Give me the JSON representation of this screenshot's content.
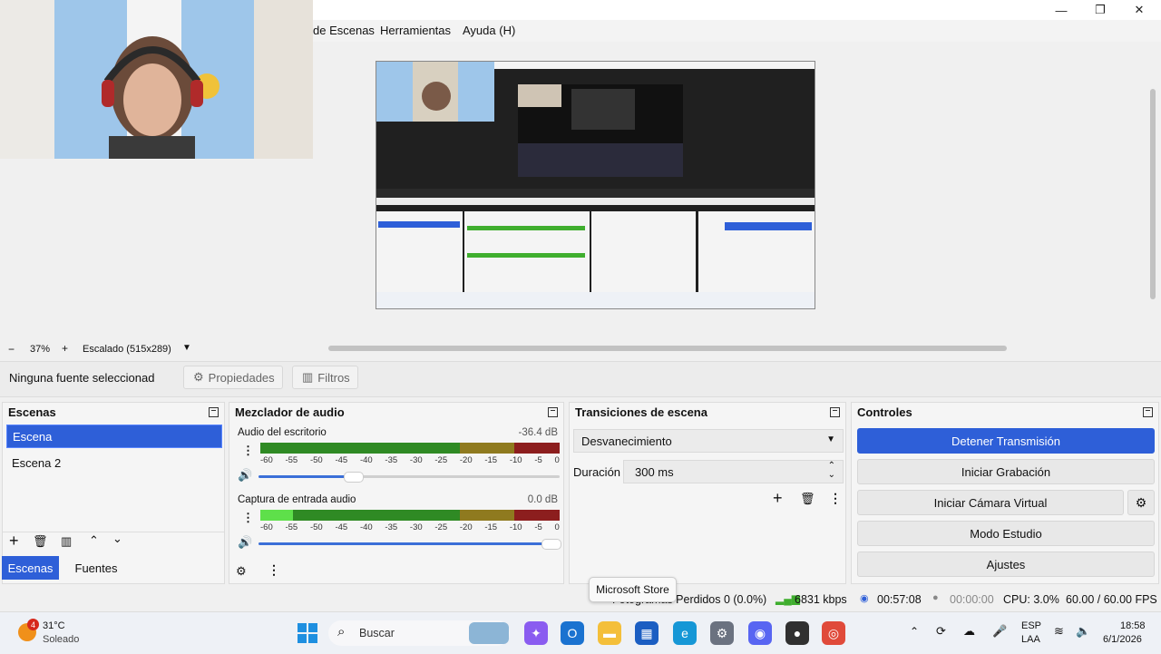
{
  "window": {
    "minimize": "—",
    "maximize": "❐",
    "close": "✕"
  },
  "menu": {
    "items": [
      "de Escenas",
      "Herramientas",
      "Ayuda (H)"
    ]
  },
  "zoom": {
    "minus": "−",
    "percent": "37%",
    "plus": "+",
    "scale": "Escalado (515x289)"
  },
  "sources_bar": {
    "status": "Ninguna fuente seleccionad",
    "properties": "Propiedades",
    "filters": "Filtros"
  },
  "scenes": {
    "title": "Escenas",
    "items": [
      "Escena",
      "Escena 2"
    ]
  },
  "mixer": {
    "title": "Mezclador de audio",
    "tracks": [
      {
        "name": "Audio del escritorio",
        "db": "-36.4 dB",
        "level": 0.0
      },
      {
        "name": "Captura de entrada audio",
        "db": "0.0 dB",
        "level": 0.2
      }
    ],
    "ticks": [
      "-60",
      "-55",
      "-50",
      "-45",
      "-40",
      "-35",
      "-30",
      "-25",
      "-20",
      "-15",
      "-10",
      "-5",
      "0"
    ]
  },
  "transitions": {
    "title": "Transiciones de escena",
    "selected": "Desvanecimiento",
    "duration_label": "Duración",
    "duration_value": "300 ms"
  },
  "controls": {
    "title": "Controles",
    "stop_stream": "Detener Transmisión",
    "start_record": "Iniciar Grabación",
    "start_vcam": "Iniciar Cámara Virtual",
    "studio_mode": "Modo Estudio",
    "settings": "Ajustes"
  },
  "tabs": {
    "scenes": "Escenas",
    "sources": "Fuentes"
  },
  "status": {
    "dropped": "Fotogramas Perdidos 0 (0.0%)",
    "bitrate": "6831 kbps",
    "stream_time": "00:57:08",
    "rec_time": "00:00:00",
    "cpu": "CPU: 3.0%",
    "fps": "60.00 / 60.00 FPS"
  },
  "tooltip": "Microsoft Store",
  "taskbar": {
    "weather_temp": "31°C",
    "weather_desc": "Soleado",
    "weather_badge": "4",
    "search": "Buscar",
    "lang1": "ESP",
    "lang2": "LAA",
    "time": "18:58",
    "date": "6/1/2026"
  },
  "colors": {
    "accent": "#2e5fd8",
    "meter_green": "#3fae2e",
    "meter_yellow": "#c9a92c",
    "meter_red": "#c22a2a"
  }
}
